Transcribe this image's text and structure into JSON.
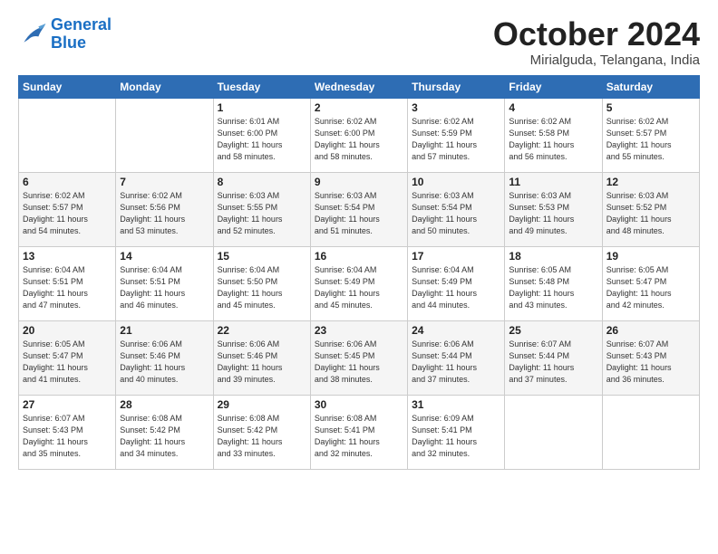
{
  "logo": {
    "line1": "General",
    "line2": "Blue"
  },
  "title": "October 2024",
  "subtitle": "Mirialguda, Telangana, India",
  "days_header": [
    "Sunday",
    "Monday",
    "Tuesday",
    "Wednesday",
    "Thursday",
    "Friday",
    "Saturday"
  ],
  "weeks": [
    [
      {
        "day": "",
        "info": ""
      },
      {
        "day": "",
        "info": ""
      },
      {
        "day": "1",
        "info": "Sunrise: 6:01 AM\nSunset: 6:00 PM\nDaylight: 11 hours\nand 58 minutes."
      },
      {
        "day": "2",
        "info": "Sunrise: 6:02 AM\nSunset: 6:00 PM\nDaylight: 11 hours\nand 58 minutes."
      },
      {
        "day": "3",
        "info": "Sunrise: 6:02 AM\nSunset: 5:59 PM\nDaylight: 11 hours\nand 57 minutes."
      },
      {
        "day": "4",
        "info": "Sunrise: 6:02 AM\nSunset: 5:58 PM\nDaylight: 11 hours\nand 56 minutes."
      },
      {
        "day": "5",
        "info": "Sunrise: 6:02 AM\nSunset: 5:57 PM\nDaylight: 11 hours\nand 55 minutes."
      }
    ],
    [
      {
        "day": "6",
        "info": "Sunrise: 6:02 AM\nSunset: 5:57 PM\nDaylight: 11 hours\nand 54 minutes."
      },
      {
        "day": "7",
        "info": "Sunrise: 6:02 AM\nSunset: 5:56 PM\nDaylight: 11 hours\nand 53 minutes."
      },
      {
        "day": "8",
        "info": "Sunrise: 6:03 AM\nSunset: 5:55 PM\nDaylight: 11 hours\nand 52 minutes."
      },
      {
        "day": "9",
        "info": "Sunrise: 6:03 AM\nSunset: 5:54 PM\nDaylight: 11 hours\nand 51 minutes."
      },
      {
        "day": "10",
        "info": "Sunrise: 6:03 AM\nSunset: 5:54 PM\nDaylight: 11 hours\nand 50 minutes."
      },
      {
        "day": "11",
        "info": "Sunrise: 6:03 AM\nSunset: 5:53 PM\nDaylight: 11 hours\nand 49 minutes."
      },
      {
        "day": "12",
        "info": "Sunrise: 6:03 AM\nSunset: 5:52 PM\nDaylight: 11 hours\nand 48 minutes."
      }
    ],
    [
      {
        "day": "13",
        "info": "Sunrise: 6:04 AM\nSunset: 5:51 PM\nDaylight: 11 hours\nand 47 minutes."
      },
      {
        "day": "14",
        "info": "Sunrise: 6:04 AM\nSunset: 5:51 PM\nDaylight: 11 hours\nand 46 minutes."
      },
      {
        "day": "15",
        "info": "Sunrise: 6:04 AM\nSunset: 5:50 PM\nDaylight: 11 hours\nand 45 minutes."
      },
      {
        "day": "16",
        "info": "Sunrise: 6:04 AM\nSunset: 5:49 PM\nDaylight: 11 hours\nand 45 minutes."
      },
      {
        "day": "17",
        "info": "Sunrise: 6:04 AM\nSunset: 5:49 PM\nDaylight: 11 hours\nand 44 minutes."
      },
      {
        "day": "18",
        "info": "Sunrise: 6:05 AM\nSunset: 5:48 PM\nDaylight: 11 hours\nand 43 minutes."
      },
      {
        "day": "19",
        "info": "Sunrise: 6:05 AM\nSunset: 5:47 PM\nDaylight: 11 hours\nand 42 minutes."
      }
    ],
    [
      {
        "day": "20",
        "info": "Sunrise: 6:05 AM\nSunset: 5:47 PM\nDaylight: 11 hours\nand 41 minutes."
      },
      {
        "day": "21",
        "info": "Sunrise: 6:06 AM\nSunset: 5:46 PM\nDaylight: 11 hours\nand 40 minutes."
      },
      {
        "day": "22",
        "info": "Sunrise: 6:06 AM\nSunset: 5:46 PM\nDaylight: 11 hours\nand 39 minutes."
      },
      {
        "day": "23",
        "info": "Sunrise: 6:06 AM\nSunset: 5:45 PM\nDaylight: 11 hours\nand 38 minutes."
      },
      {
        "day": "24",
        "info": "Sunrise: 6:06 AM\nSunset: 5:44 PM\nDaylight: 11 hours\nand 37 minutes."
      },
      {
        "day": "25",
        "info": "Sunrise: 6:07 AM\nSunset: 5:44 PM\nDaylight: 11 hours\nand 37 minutes."
      },
      {
        "day": "26",
        "info": "Sunrise: 6:07 AM\nSunset: 5:43 PM\nDaylight: 11 hours\nand 36 minutes."
      }
    ],
    [
      {
        "day": "27",
        "info": "Sunrise: 6:07 AM\nSunset: 5:43 PM\nDaylight: 11 hours\nand 35 minutes."
      },
      {
        "day": "28",
        "info": "Sunrise: 6:08 AM\nSunset: 5:42 PM\nDaylight: 11 hours\nand 34 minutes."
      },
      {
        "day": "29",
        "info": "Sunrise: 6:08 AM\nSunset: 5:42 PM\nDaylight: 11 hours\nand 33 minutes."
      },
      {
        "day": "30",
        "info": "Sunrise: 6:08 AM\nSunset: 5:41 PM\nDaylight: 11 hours\nand 32 minutes."
      },
      {
        "day": "31",
        "info": "Sunrise: 6:09 AM\nSunset: 5:41 PM\nDaylight: 11 hours\nand 32 minutes."
      },
      {
        "day": "",
        "info": ""
      },
      {
        "day": "",
        "info": ""
      }
    ]
  ]
}
